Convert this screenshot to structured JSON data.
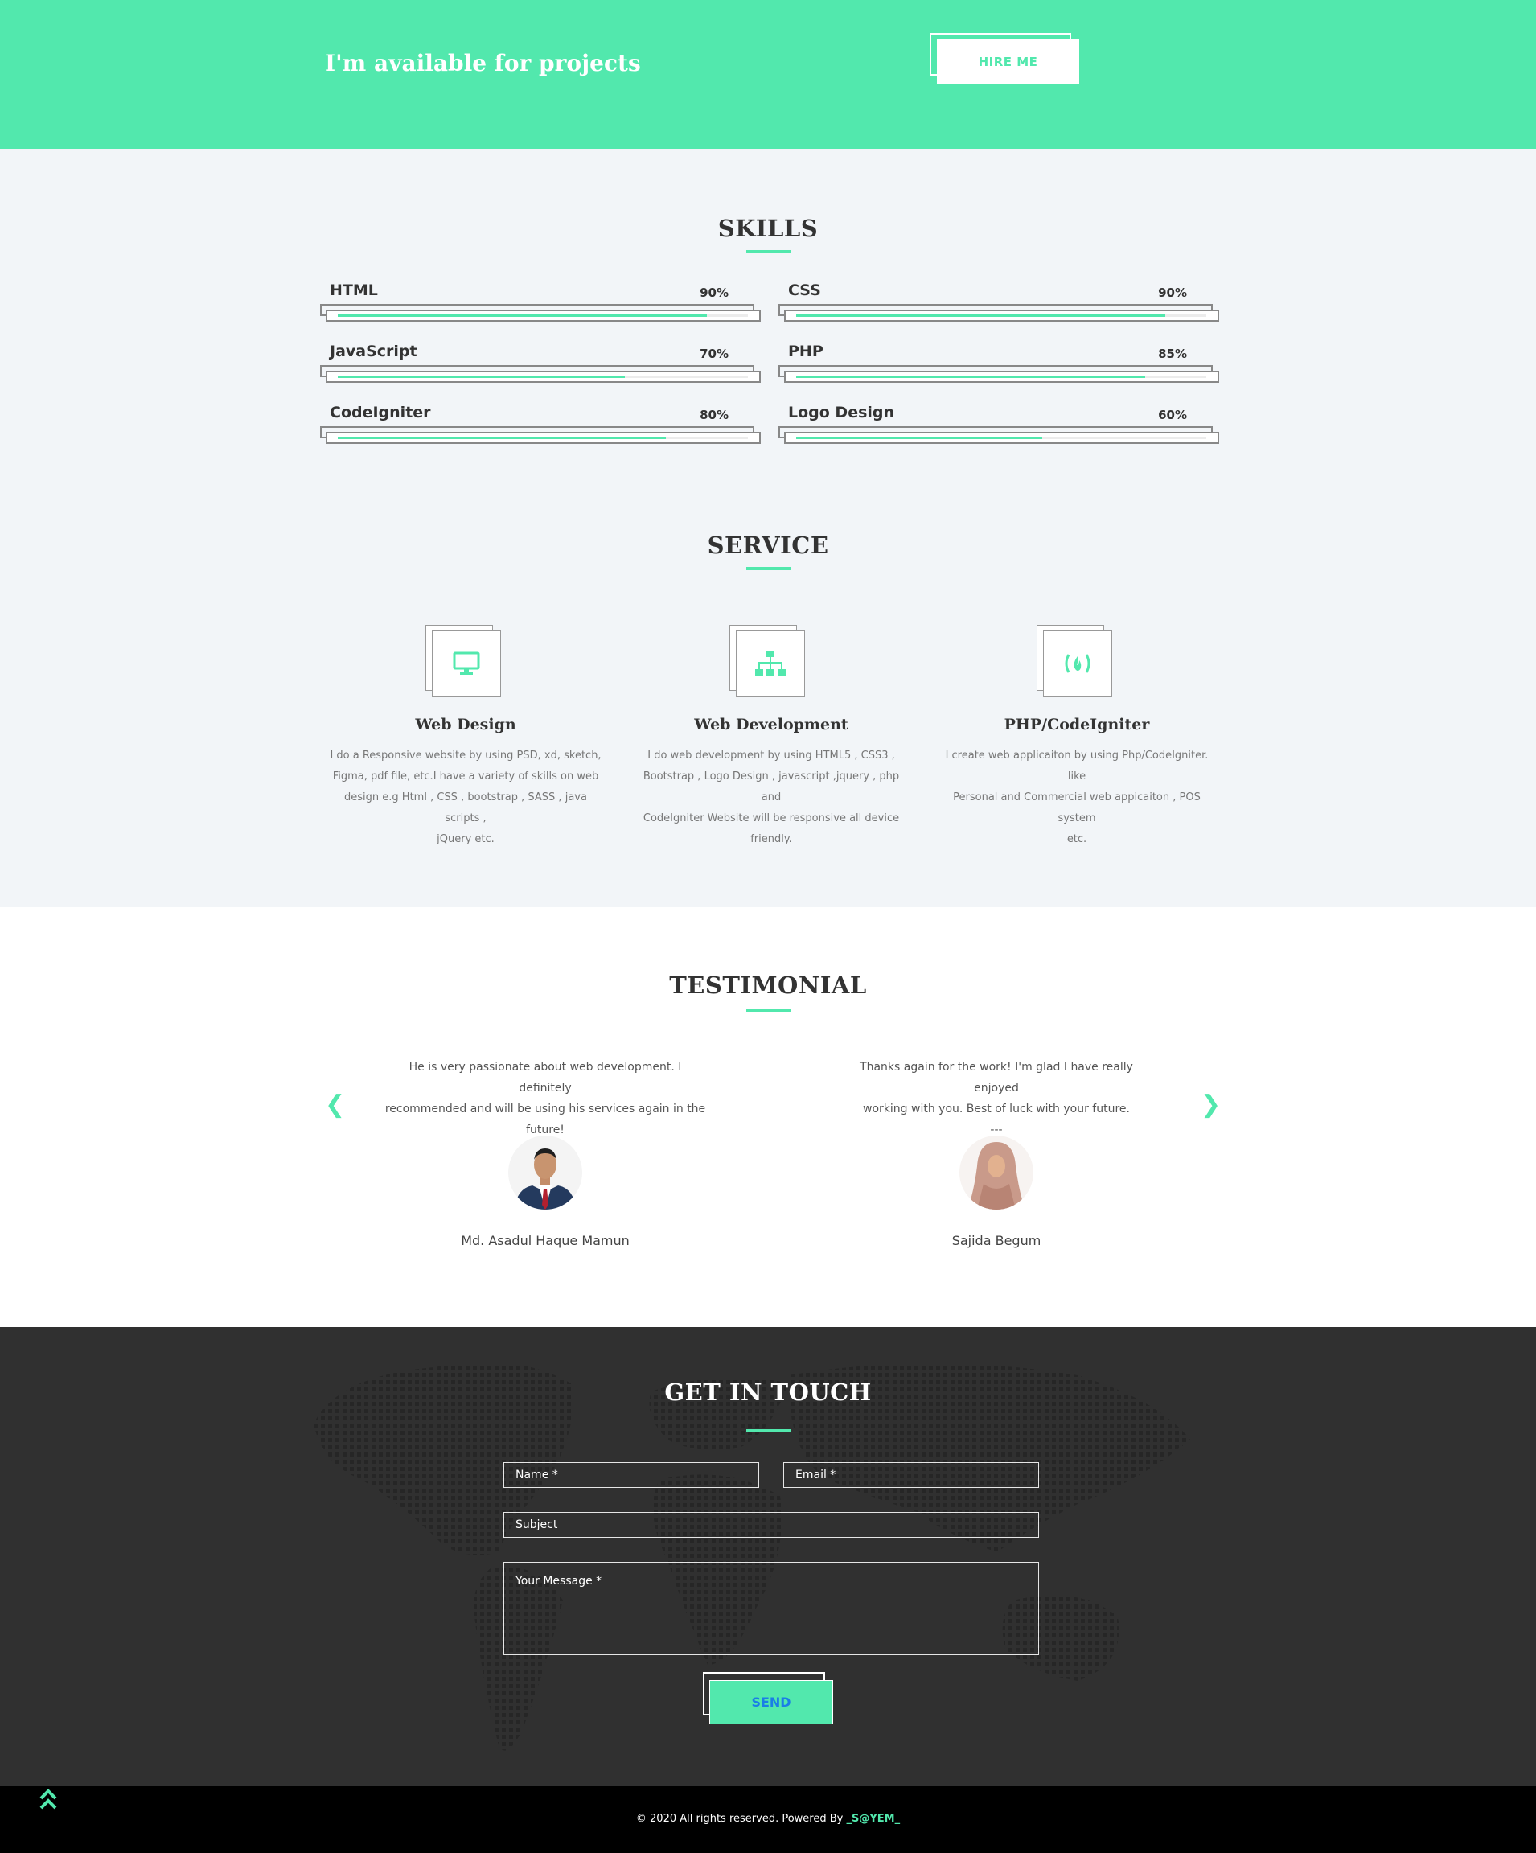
{
  "cta": {
    "title": "I'm available for projects",
    "hire_label": "HIRE ME"
  },
  "skills": {
    "title": "SKILLS",
    "items": [
      {
        "name": "HTML",
        "percent_label": "90%",
        "level": 0.9
      },
      {
        "name": "CSS",
        "percent_label": "90%",
        "level": 0.9
      },
      {
        "name": "JavaScript",
        "percent_label": "70%",
        "level": 0.7
      },
      {
        "name": "PHP",
        "percent_label": "85%",
        "level": 0.85
      },
      {
        "name": "CodeIgniter",
        "percent_label": "80%",
        "level": 0.8
      },
      {
        "name": "Logo Design",
        "percent_label": "60%",
        "level": 0.6
      }
    ]
  },
  "service": {
    "title": "SERVICE",
    "items": [
      {
        "icon": "monitor-icon",
        "title": "Web Design",
        "lines": [
          "I do a Responsive website by using PSD, xd, sketch,",
          "Figma, pdf file, etc.I have a variety of skills on web",
          "design e.g Html , CSS , bootstrap , SASS , java scripts ,",
          "jQuery etc."
        ]
      },
      {
        "icon": "sitemap-icon",
        "title": "Web Development",
        "lines": [
          "I do web development by using HTML5 , CSS3 ,",
          "Bootstrap , Logo Design , javascript ,jquery , php and",
          "CodeIgniter Website will be responsive all device",
          "friendly."
        ]
      },
      {
        "icon": "codeigniter-icon",
        "title": "PHP/CodeIgniter",
        "lines": [
          "I create web applicaiton by using Php/CodeIgniter. like",
          "Personal and Commercial web appicaiton , POS system",
          "etc."
        ]
      }
    ]
  },
  "testimonial": {
    "title": "TESTIMONIAL",
    "items": [
      {
        "lines": [
          "He is very passionate about web development. I definitely",
          "recommended and will be using his services again in the",
          "future!"
        ],
        "name": "Md. Asadul Haque Mamun"
      },
      {
        "lines": [
          "Thanks again for the work! I'm glad I have really enjoyed",
          "working with you. Best of luck with your future.",
          "---"
        ],
        "name": "Sajida Begum"
      }
    ]
  },
  "contact": {
    "title": "GET IN TOUCH",
    "name_placeholder": "Name *",
    "email_placeholder": "Email *",
    "subject_placeholder": "Subject",
    "message_placeholder": "Your Message *",
    "send_label": "SEND"
  },
  "footer": {
    "text": "© 2020 All rights reserved. Powered By ",
    "brand": "_S@YEM_"
  },
  "colors": {
    "accent": "#52e8ad",
    "dark": "#303030",
    "grey_band": "#f2f5f8"
  }
}
